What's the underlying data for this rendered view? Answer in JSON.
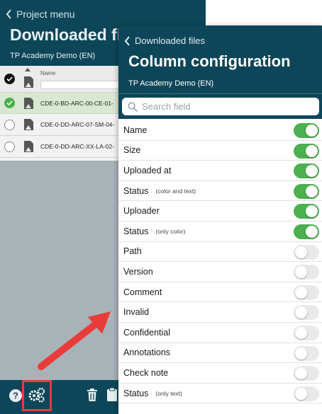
{
  "background": {
    "back_label": "Project menu",
    "title": "Downloaded files",
    "project": "TP Academy Demo (EN)",
    "table": {
      "name_header": "Name",
      "files": [
        {
          "name": "CDE-0-BD-ARC-00-CE-01-",
          "selected": true
        },
        {
          "name": "CDE-0-DD-ARC-07-SM-04-",
          "selected": false
        },
        {
          "name": "CDE-0-DD-ARC-XX-LA-02-",
          "selected": false
        }
      ]
    },
    "footer_icons": [
      "help-icon",
      "settings-gears-icon",
      "trash-icon",
      "clipboard-icon"
    ]
  },
  "popover": {
    "back_label": "Downloaded files",
    "title": "Column configuration",
    "project": "TP Academy Demo (EN)",
    "search": {
      "placeholder": "Search field",
      "value": ""
    },
    "columns": [
      {
        "label": "Name",
        "note": "",
        "enabled": true
      },
      {
        "label": "Size",
        "note": "",
        "enabled": true
      },
      {
        "label": "Uploaded at",
        "note": "",
        "enabled": true
      },
      {
        "label": "Status",
        "note": "(color and text)",
        "enabled": true
      },
      {
        "label": "Uploader",
        "note": "",
        "enabled": true
      },
      {
        "label": "Status",
        "note": "(only color)",
        "enabled": true
      },
      {
        "label": "Path",
        "note": "",
        "enabled": false
      },
      {
        "label": "Version",
        "note": "",
        "enabled": false
      },
      {
        "label": "Comment",
        "note": "",
        "enabled": false
      },
      {
        "label": "Invalid",
        "note": "",
        "enabled": false
      },
      {
        "label": "Confidential",
        "note": "",
        "enabled": false
      },
      {
        "label": "Annotations",
        "note": "",
        "enabled": false
      },
      {
        "label": "Check note",
        "note": "",
        "enabled": false
      },
      {
        "label": "Status",
        "note": "(only text)",
        "enabled": false
      }
    ]
  },
  "colors": {
    "header_bg": "#0d4658",
    "toggle_on": "#4caf50",
    "highlight": "#ea3b3b"
  }
}
